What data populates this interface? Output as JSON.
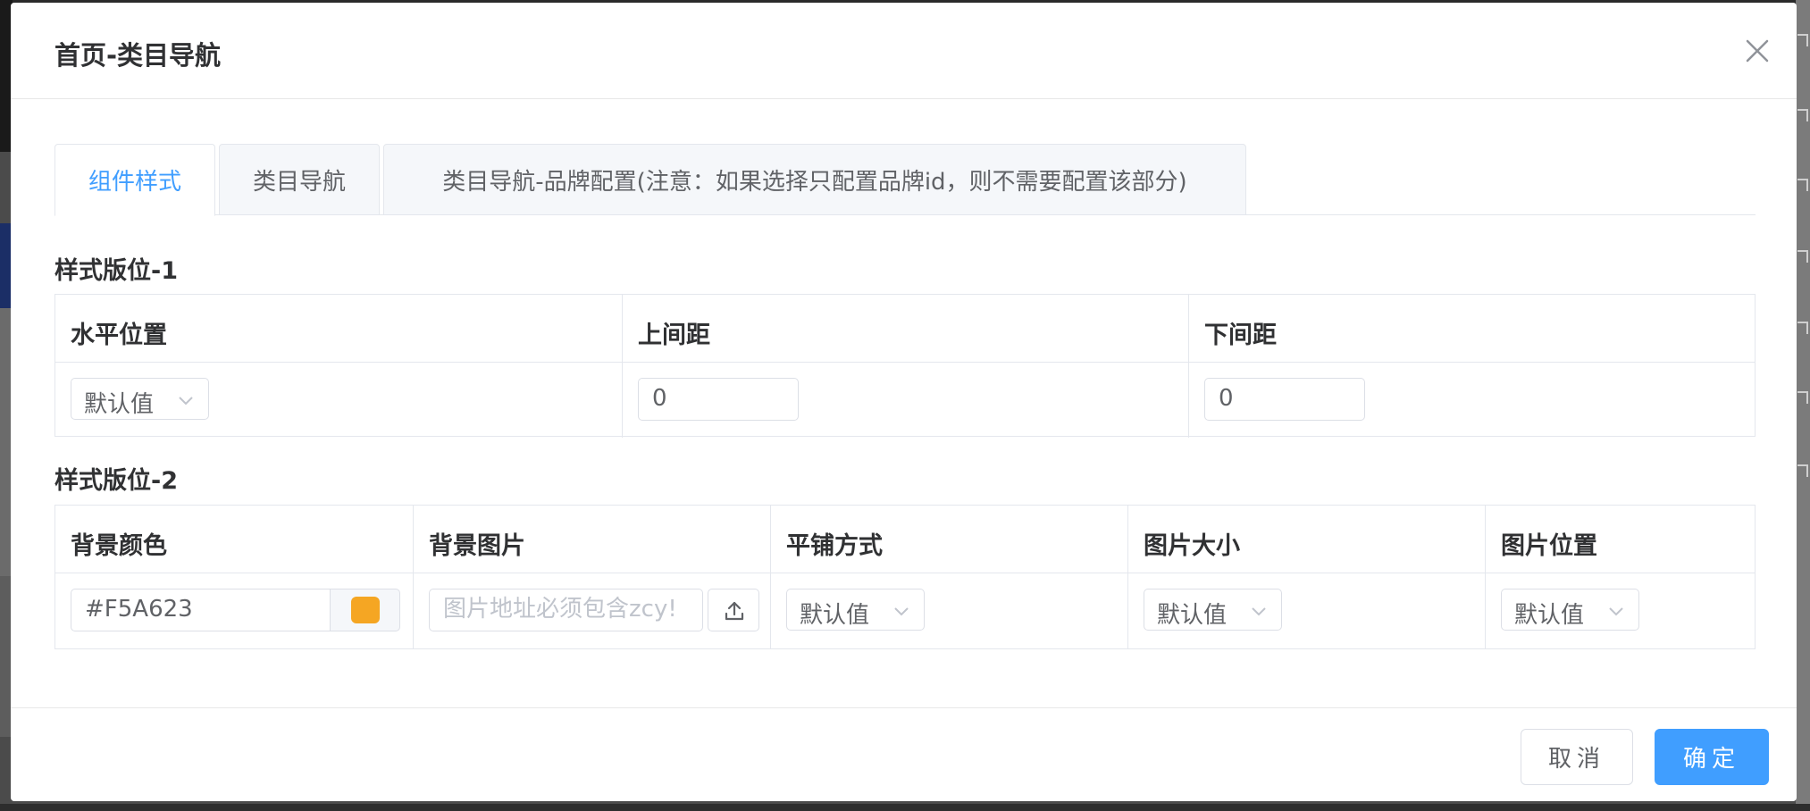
{
  "dialog": {
    "title": "首页-类目导航",
    "close_icon": "close-icon"
  },
  "tabs": [
    {
      "label": "组件样式",
      "active": true
    },
    {
      "label": "类目导航",
      "active": false
    },
    {
      "label": "类目导航-品牌配置(注意：如果选择只配置品牌id，则不需要配置该部分)",
      "active": false
    }
  ],
  "section1": {
    "title": "样式版位-1",
    "headers": [
      "水平位置",
      "上间距",
      "下间距"
    ],
    "horizontal_position": "默认值",
    "top_margin": "0",
    "bottom_margin": "0"
  },
  "section2": {
    "title": "样式版位-2",
    "headers": [
      "背景颜色",
      "背景图片",
      "平铺方式",
      "图片大小",
      "图片位置"
    ],
    "bg_color_value": "#F5A623",
    "bg_color_swatch": "#F5A623",
    "bg_image_placeholder": "图片地址必须包含zcy!",
    "tile_mode": "默认值",
    "image_size": "默认值",
    "image_position": "默认值"
  },
  "footer": {
    "cancel_label": "取消",
    "ok_label": "确定"
  },
  "colors": {
    "primary": "#409EFF",
    "swatch": "#F5A623"
  }
}
